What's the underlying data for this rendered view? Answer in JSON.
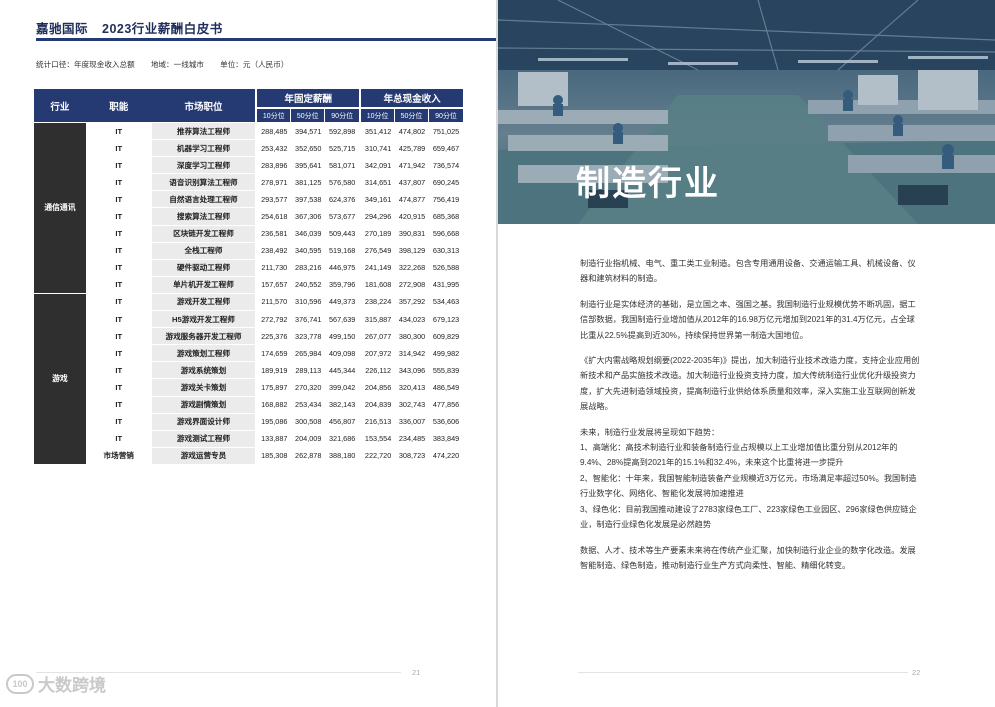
{
  "left_page": {
    "doc_title_company": "嘉驰国际",
    "doc_title_report": "2023行业薪酬白皮书",
    "meta": {
      "scope": "统计口径：年度现金收入总额",
      "region": "地域：一线城市",
      "unit": "单位：元（人民币）"
    },
    "table": {
      "headers": {
        "industry": "行业",
        "function": "职能",
        "position": "市场职位",
        "fixed_group": "年固定薪酬",
        "total_group": "年总现金收入",
        "p10": "10分位",
        "p50": "50分位",
        "p90": "90分位"
      },
      "groups": [
        {
          "industry": "通信通讯",
          "rows": [
            {
              "func": "IT",
              "role": "推荐算法工程师",
              "f10": "288,485",
              "f50": "394,571",
              "f90": "592,898",
              "t10": "351,412",
              "t50": "474,802",
              "t90": "751,025"
            },
            {
              "func": "IT",
              "role": "机器学习工程师",
              "f10": "253,432",
              "f50": "352,650",
              "f90": "525,715",
              "t10": "310,741",
              "t50": "425,789",
              "t90": "659,467"
            },
            {
              "func": "IT",
              "role": "深度学习工程师",
              "f10": "283,896",
              "f50": "395,641",
              "f90": "581,071",
              "t10": "342,091",
              "t50": "471,942",
              "t90": "736,574"
            },
            {
              "func": "IT",
              "role": "语音识别算法工程师",
              "f10": "278,971",
              "f50": "381,125",
              "f90": "576,580",
              "t10": "314,651",
              "t50": "437,807",
              "t90": "690,245"
            },
            {
              "func": "IT",
              "role": "自然语言处理工程师",
              "f10": "293,577",
              "f50": "397,538",
              "f90": "624,376",
              "t10": "349,161",
              "t50": "474,877",
              "t90": "756,419"
            },
            {
              "func": "IT",
              "role": "搜索算法工程师",
              "f10": "254,618",
              "f50": "367,306",
              "f90": "573,677",
              "t10": "294,296",
              "t50": "420,915",
              "t90": "685,368"
            },
            {
              "func": "IT",
              "role": "区块链开发工程师",
              "f10": "236,581",
              "f50": "346,039",
              "f90": "509,443",
              "t10": "270,189",
              "t50": "390,831",
              "t90": "596,668"
            },
            {
              "func": "IT",
              "role": "全栈工程师",
              "f10": "238,492",
              "f50": "340,595",
              "f90": "519,168",
              "t10": "276,549",
              "t50": "398,129",
              "t90": "630,313"
            },
            {
              "func": "IT",
              "role": "硬件驱动工程师",
              "f10": "211,730",
              "f50": "283,216",
              "f90": "446,975",
              "t10": "241,149",
              "t50": "322,268",
              "t90": "526,588"
            },
            {
              "func": "IT",
              "role": "单片机开发工程师",
              "f10": "157,657",
              "f50": "240,552",
              "f90": "359,796",
              "t10": "181,608",
              "t50": "272,908",
              "t90": "431,995"
            }
          ]
        },
        {
          "industry": "游戏",
          "rows": [
            {
              "func": "IT",
              "role": "游戏开发工程师",
              "f10": "211,570",
              "f50": "310,596",
              "f90": "449,373",
              "t10": "238,224",
              "t50": "357,292",
              "t90": "534,463"
            },
            {
              "func": "IT",
              "role": "H5游戏开发工程师",
              "f10": "272,792",
              "f50": "376,741",
              "f90": "567,639",
              "t10": "315,887",
              "t50": "434,023",
              "t90": "679,123"
            },
            {
              "func": "IT",
              "role": "游戏服务器开发工程师",
              "f10": "225,376",
              "f50": "323,778",
              "f90": "499,150",
              "t10": "267,077",
              "t50": "380,300",
              "t90": "609,829"
            },
            {
              "func": "IT",
              "role": "游戏策划工程师",
              "f10": "174,659",
              "f50": "265,984",
              "f90": "409,098",
              "t10": "207,972",
              "t50": "314,942",
              "t90": "499,982"
            },
            {
              "func": "IT",
              "role": "游戏系统策划",
              "f10": "189,919",
              "f50": "289,113",
              "f90": "445,344",
              "t10": "226,112",
              "t50": "343,096",
              "t90": "555,839"
            },
            {
              "func": "IT",
              "role": "游戏关卡策划",
              "f10": "175,897",
              "f50": "270,320",
              "f90": "399,042",
              "t10": "204,856",
              "t50": "320,413",
              "t90": "486,549"
            },
            {
              "func": "IT",
              "role": "游戏剧情策划",
              "f10": "168,882",
              "f50": "253,434",
              "f90": "382,143",
              "t10": "204,839",
              "t50": "302,743",
              "t90": "477,856"
            },
            {
              "func": "IT",
              "role": "游戏界面设计师",
              "f10": "195,086",
              "f50": "300,508",
              "f90": "456,807",
              "t10": "216,513",
              "t50": "336,007",
              "t90": "536,606"
            },
            {
              "func": "IT",
              "role": "游戏测试工程师",
              "f10": "133,887",
              "f50": "204,009",
              "f90": "321,686",
              "t10": "153,554",
              "t50": "234,485",
              "t90": "383,849"
            },
            {
              "func": "市场营销",
              "role": "游戏运营专员",
              "f10": "185,308",
              "f50": "262,878",
              "f90": "388,180",
              "t10": "222,720",
              "t50": "308,723",
              "t90": "474,220"
            }
          ]
        }
      ]
    },
    "page_number": "21"
  },
  "right_page": {
    "hero_title": "制造行业",
    "paragraphs": [
      "制造行业指机械、电气、重工类工业制造。包含专用通用设备、交通运输工具、机械设备、仪器和建筑材料的制造。",
      "制造行业是实体经济的基础，是立国之本、强国之基。我国制造行业规模优势不断巩固，据工信部数据，我国制造行业增加值从2012年的16.98万亿元增加到2021年的31.4万亿元，占全球比重从22.5%提高到近30%，持续保持世界第一制造大国地位。",
      "《扩大内需战略规划纲要(2022-2035年)》提出，加大制造行业技术改造力度，支持企业应用创新技术和产品实施技术改造。加大制造行业投资支持力度，加大传统制造行业优化升级投资力度，扩大先进制造领域投资，提高制造行业供给体系质量和效率，深入实施工业互联网创新发展战略。"
    ],
    "trend_lines": [
      "未来，制造行业发展将呈现如下趋势：",
      "1、高端化：高技术制造行业和装备制造行业占规模以上工业增加值比重分别从2012年的9.4%、28%提高到2021年的15.1%和32.4%，未来这个比重将进一步提升",
      "2、智能化：十年来，我国智能制造装备产业规模近3万亿元，市场满足率超过50%。我国制造行业数字化、网络化、智能化发展将加速推进",
      "3、绿色化：目前我国推动建设了2783家绿色工厂、223家绿色工业园区、296家绿色供应链企业，制造行业绿色化发展是必然趋势"
    ],
    "closing": "数据、人才、技术等生产要素未来将在传统产业汇聚，加快制造行业企业的数字化改造。发展智能制造、绿色制造，推动制造行业生产方式向柔性、智能、精细化转变。",
    "page_number": "22"
  },
  "watermark": {
    "logo": "100",
    "text": "大数跨境"
  }
}
